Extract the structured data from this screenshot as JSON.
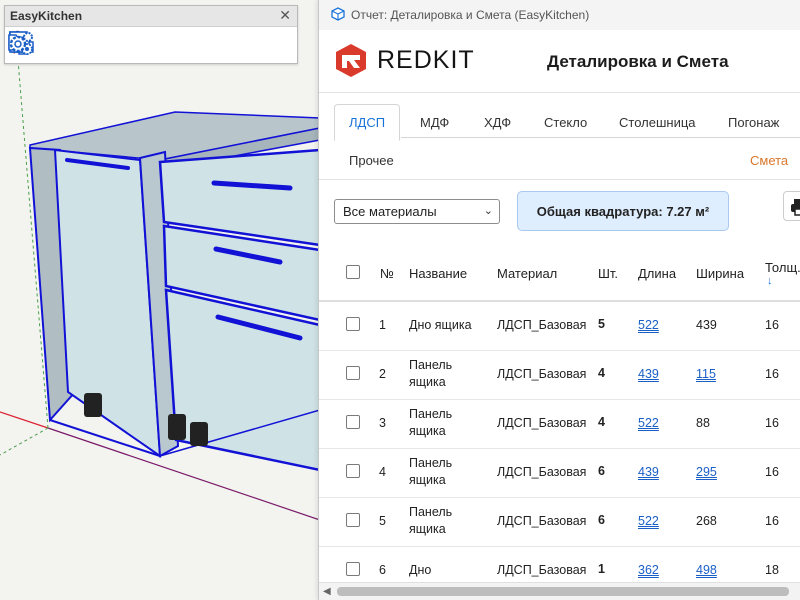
{
  "toolbar": {
    "title": "EasyKitchen",
    "close": "✕",
    "icons": [
      "select-arrow-icon",
      "hand-pointer-icon",
      "edit-document-icon",
      "swap-arrows-icon",
      "edit-frame-icon",
      "folders-icon",
      "spreadsheet-icon",
      "folder-settings-icon",
      "gear-icon"
    ]
  },
  "window": {
    "title": "Отчет: Деталировка и Смета (EasyKitchen)"
  },
  "brand": {
    "logo_text": "REDKIT",
    "report_title": "Деталировка и Смета"
  },
  "tabs": [
    {
      "label": "ЛДСП",
      "active": true
    },
    {
      "label": "МДФ"
    },
    {
      "label": "ХДФ"
    },
    {
      "label": "Стекло"
    },
    {
      "label": "Столешница"
    },
    {
      "label": "Погонаж"
    },
    {
      "label": "Прочее"
    }
  ],
  "estimate_link": "Смета",
  "filter": {
    "selected": "Все материалы"
  },
  "total_area": {
    "label": "Общая квадратура:",
    "value": "7.27 м²"
  },
  "table": {
    "headers": {
      "num": "№",
      "name": "Название",
      "material": "Материал",
      "qty": "Шт.",
      "length": "Длина",
      "width": "Ширина",
      "thickness": "Толщ.",
      "sort_icon": "↓"
    },
    "rows": [
      {
        "num": "1",
        "name": "Дно ящика",
        "material": "ЛДСП_Базовая",
        "qty": "5",
        "length": "522",
        "width": "439",
        "thickness": "16",
        "len_link": true,
        "wid_link": false
      },
      {
        "num": "2",
        "name": "Панель ящика",
        "material": "ЛДСП_Базовая",
        "qty": "4",
        "length": "439",
        "width": "115",
        "thickness": "16",
        "len_link": true,
        "wid_link": true
      },
      {
        "num": "3",
        "name": "Панель ящика",
        "material": "ЛДСП_Базовая",
        "qty": "4",
        "length": "522",
        "width": "88",
        "thickness": "16",
        "len_link": true,
        "wid_link": false
      },
      {
        "num": "4",
        "name": "Панель ящика",
        "material": "ЛДСП_Базовая",
        "qty": "6",
        "length": "439",
        "width": "295",
        "thickness": "16",
        "len_link": true,
        "wid_link": true
      },
      {
        "num": "5",
        "name": "Панель ящика",
        "material": "ЛДСП_Базовая",
        "qty": "6",
        "length": "522",
        "width": "268",
        "thickness": "16",
        "len_link": true,
        "wid_link": false
      },
      {
        "num": "6",
        "name": "Дно",
        "material": "ЛДСП_Базовая",
        "qty": "1",
        "length": "362",
        "width": "498",
        "thickness": "18",
        "len_link": true,
        "wid_link": true
      }
    ]
  },
  "colors": {
    "accent": "#1a73d8",
    "link_orange": "#d9772b",
    "model_blue": "#1212d6",
    "panel_fill": "#cfe3e6"
  }
}
